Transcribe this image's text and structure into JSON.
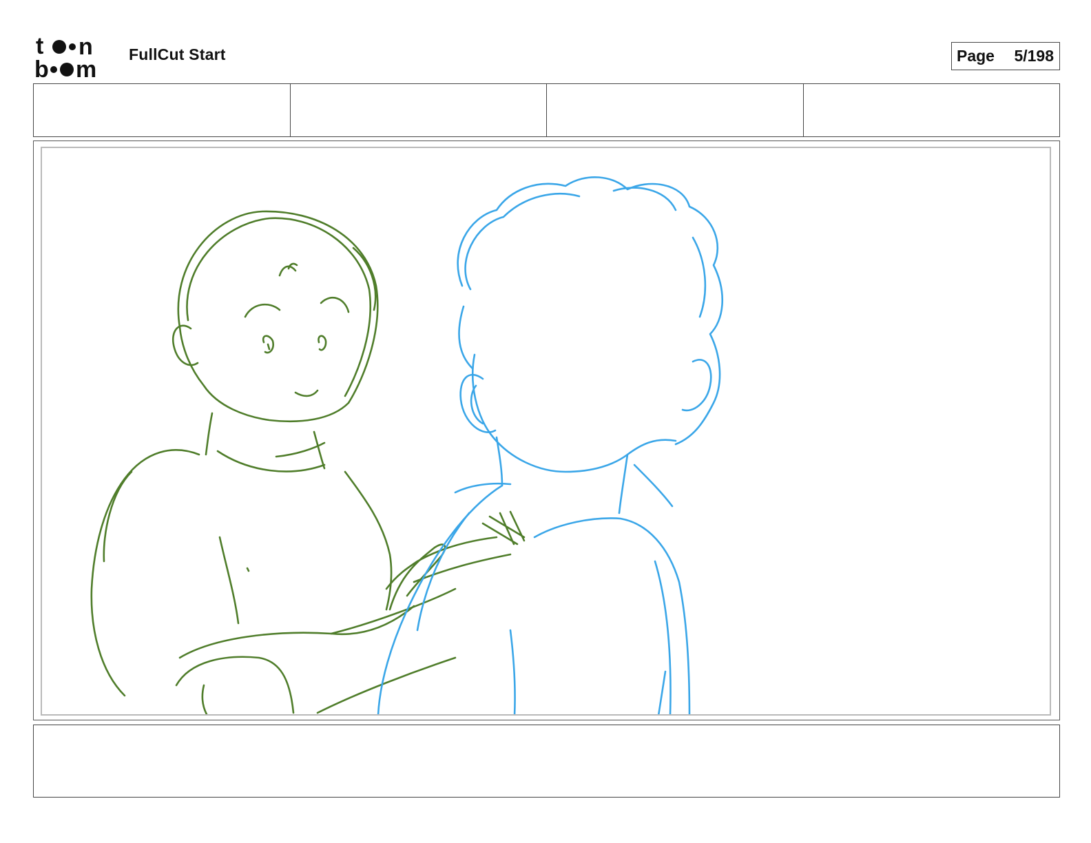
{
  "header": {
    "logo_text": "toon boom",
    "title": "FullCut Start",
    "page_label": "Page",
    "page_value": "5/198"
  },
  "info_row": {
    "cells": [
      "",
      "",
      "",
      ""
    ]
  },
  "panel": {
    "subject": "",
    "colors": {
      "left_figure": "#4f7d2a",
      "right_figure": "#3aa6e8",
      "frame": "#b9b9b9"
    }
  },
  "notes": {
    "text": ""
  }
}
